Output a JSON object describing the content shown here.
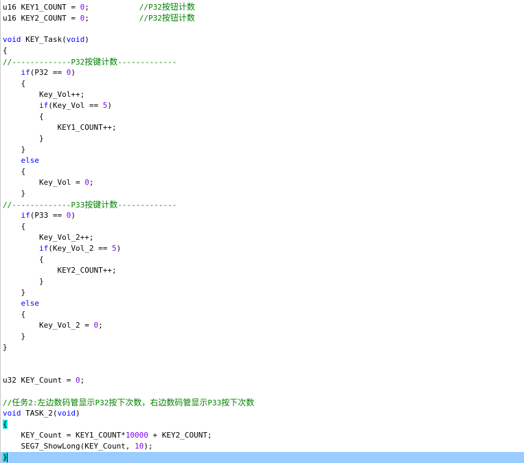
{
  "code_lines": [
    {
      "parts": [
        {
          "t": "u16 KEY1_COUNT = "
        },
        {
          "t": "0",
          "c": "num"
        },
        {
          "t": ";           "
        },
        {
          "t": "//P32按钮计数",
          "c": "cmt"
        }
      ]
    },
    {
      "parts": [
        {
          "t": "u16 KEY2_COUNT = "
        },
        {
          "t": "0",
          "c": "num"
        },
        {
          "t": ";           "
        },
        {
          "t": "//P32按钮计数",
          "c": "cmt"
        }
      ]
    },
    {
      "parts": []
    },
    {
      "parts": [
        {
          "t": "void",
          "c": "kw"
        },
        {
          "t": " KEY_Task("
        },
        {
          "t": "void",
          "c": "kw"
        },
        {
          "t": ")"
        }
      ]
    },
    {
      "parts": [
        {
          "t": "{"
        }
      ]
    },
    {
      "parts": [
        {
          "t": "//-------------P32按键计数-------------",
          "c": "cmt"
        }
      ]
    },
    {
      "parts": [
        {
          "t": "    "
        },
        {
          "t": "if",
          "c": "kw"
        },
        {
          "t": "(P32 == "
        },
        {
          "t": "0",
          "c": "num"
        },
        {
          "t": ")"
        }
      ]
    },
    {
      "parts": [
        {
          "t": "    {"
        }
      ]
    },
    {
      "parts": [
        {
          "t": "        Key_Vol++;"
        }
      ]
    },
    {
      "parts": [
        {
          "t": "        "
        },
        {
          "t": "if",
          "c": "kw"
        },
        {
          "t": "(Key_Vol == "
        },
        {
          "t": "5",
          "c": "num"
        },
        {
          "t": ")"
        }
      ]
    },
    {
      "parts": [
        {
          "t": "        {"
        }
      ]
    },
    {
      "parts": [
        {
          "t": "            KEY1_COUNT++;"
        }
      ]
    },
    {
      "parts": [
        {
          "t": "        }"
        }
      ]
    },
    {
      "parts": [
        {
          "t": "    }"
        }
      ]
    },
    {
      "parts": [
        {
          "t": "    "
        },
        {
          "t": "else",
          "c": "kw"
        }
      ]
    },
    {
      "parts": [
        {
          "t": "    {"
        }
      ]
    },
    {
      "parts": [
        {
          "t": "        Key_Vol = "
        },
        {
          "t": "0",
          "c": "num"
        },
        {
          "t": ";"
        }
      ]
    },
    {
      "parts": [
        {
          "t": "    }"
        }
      ]
    },
    {
      "parts": [
        {
          "t": "//-------------P33按键计数-------------",
          "c": "cmt"
        }
      ]
    },
    {
      "parts": [
        {
          "t": "    "
        },
        {
          "t": "if",
          "c": "kw"
        },
        {
          "t": "(P33 == "
        },
        {
          "t": "0",
          "c": "num"
        },
        {
          "t": ")"
        }
      ]
    },
    {
      "parts": [
        {
          "t": "    {"
        }
      ]
    },
    {
      "parts": [
        {
          "t": "        Key_Vol_2++;"
        }
      ]
    },
    {
      "parts": [
        {
          "t": "        "
        },
        {
          "t": "if",
          "c": "kw"
        },
        {
          "t": "(Key_Vol_2 == "
        },
        {
          "t": "5",
          "c": "num"
        },
        {
          "t": ")"
        }
      ]
    },
    {
      "parts": [
        {
          "t": "        {"
        }
      ]
    },
    {
      "parts": [
        {
          "t": "            KEY2_COUNT++;"
        }
      ]
    },
    {
      "parts": [
        {
          "t": "        }"
        }
      ]
    },
    {
      "parts": [
        {
          "t": "    }"
        }
      ]
    },
    {
      "parts": [
        {
          "t": "    "
        },
        {
          "t": "else",
          "c": "kw"
        }
      ]
    },
    {
      "parts": [
        {
          "t": "    {"
        }
      ]
    },
    {
      "parts": [
        {
          "t": "        Key_Vol_2 = "
        },
        {
          "t": "0",
          "c": "num"
        },
        {
          "t": ";"
        }
      ]
    },
    {
      "parts": [
        {
          "t": "    }"
        }
      ]
    },
    {
      "parts": [
        {
          "t": "}"
        }
      ]
    },
    {
      "parts": []
    },
    {
      "parts": []
    },
    {
      "parts": [
        {
          "t": "u32 KEY_Count = "
        },
        {
          "t": "0",
          "c": "num"
        },
        {
          "t": ";"
        }
      ]
    },
    {
      "parts": []
    },
    {
      "parts": [
        {
          "t": "//任务2:左边数码管显示P32按下次数，右边数码管显示P33按下次数",
          "c": "cmt"
        }
      ]
    },
    {
      "parts": [
        {
          "t": "void",
          "c": "kw"
        },
        {
          "t": " TASK_2("
        },
        {
          "t": "void",
          "c": "kw"
        },
        {
          "t": ")"
        }
      ]
    },
    {
      "parts": [
        {
          "t": "{",
          "c": "brace-hl"
        }
      ]
    },
    {
      "parts": [
        {
          "t": "    KEY_Count = KEY1_COUNT*"
        },
        {
          "t": "10000",
          "c": "num"
        },
        {
          "t": " + KEY2_COUNT;"
        }
      ]
    },
    {
      "parts": [
        {
          "t": "    SEG7_ShowLong(KEY_Count, "
        },
        {
          "t": "10",
          "c": "num"
        },
        {
          "t": ");"
        }
      ]
    },
    {
      "parts": [
        {
          "t": "}",
          "c": "brace-hl"
        }
      ]
    }
  ],
  "colors": {
    "keyword": "#0000ff",
    "number": "#8000ff",
    "comment": "#008000",
    "current_line": "#99ccff",
    "brace_match": "#00e5e5"
  }
}
